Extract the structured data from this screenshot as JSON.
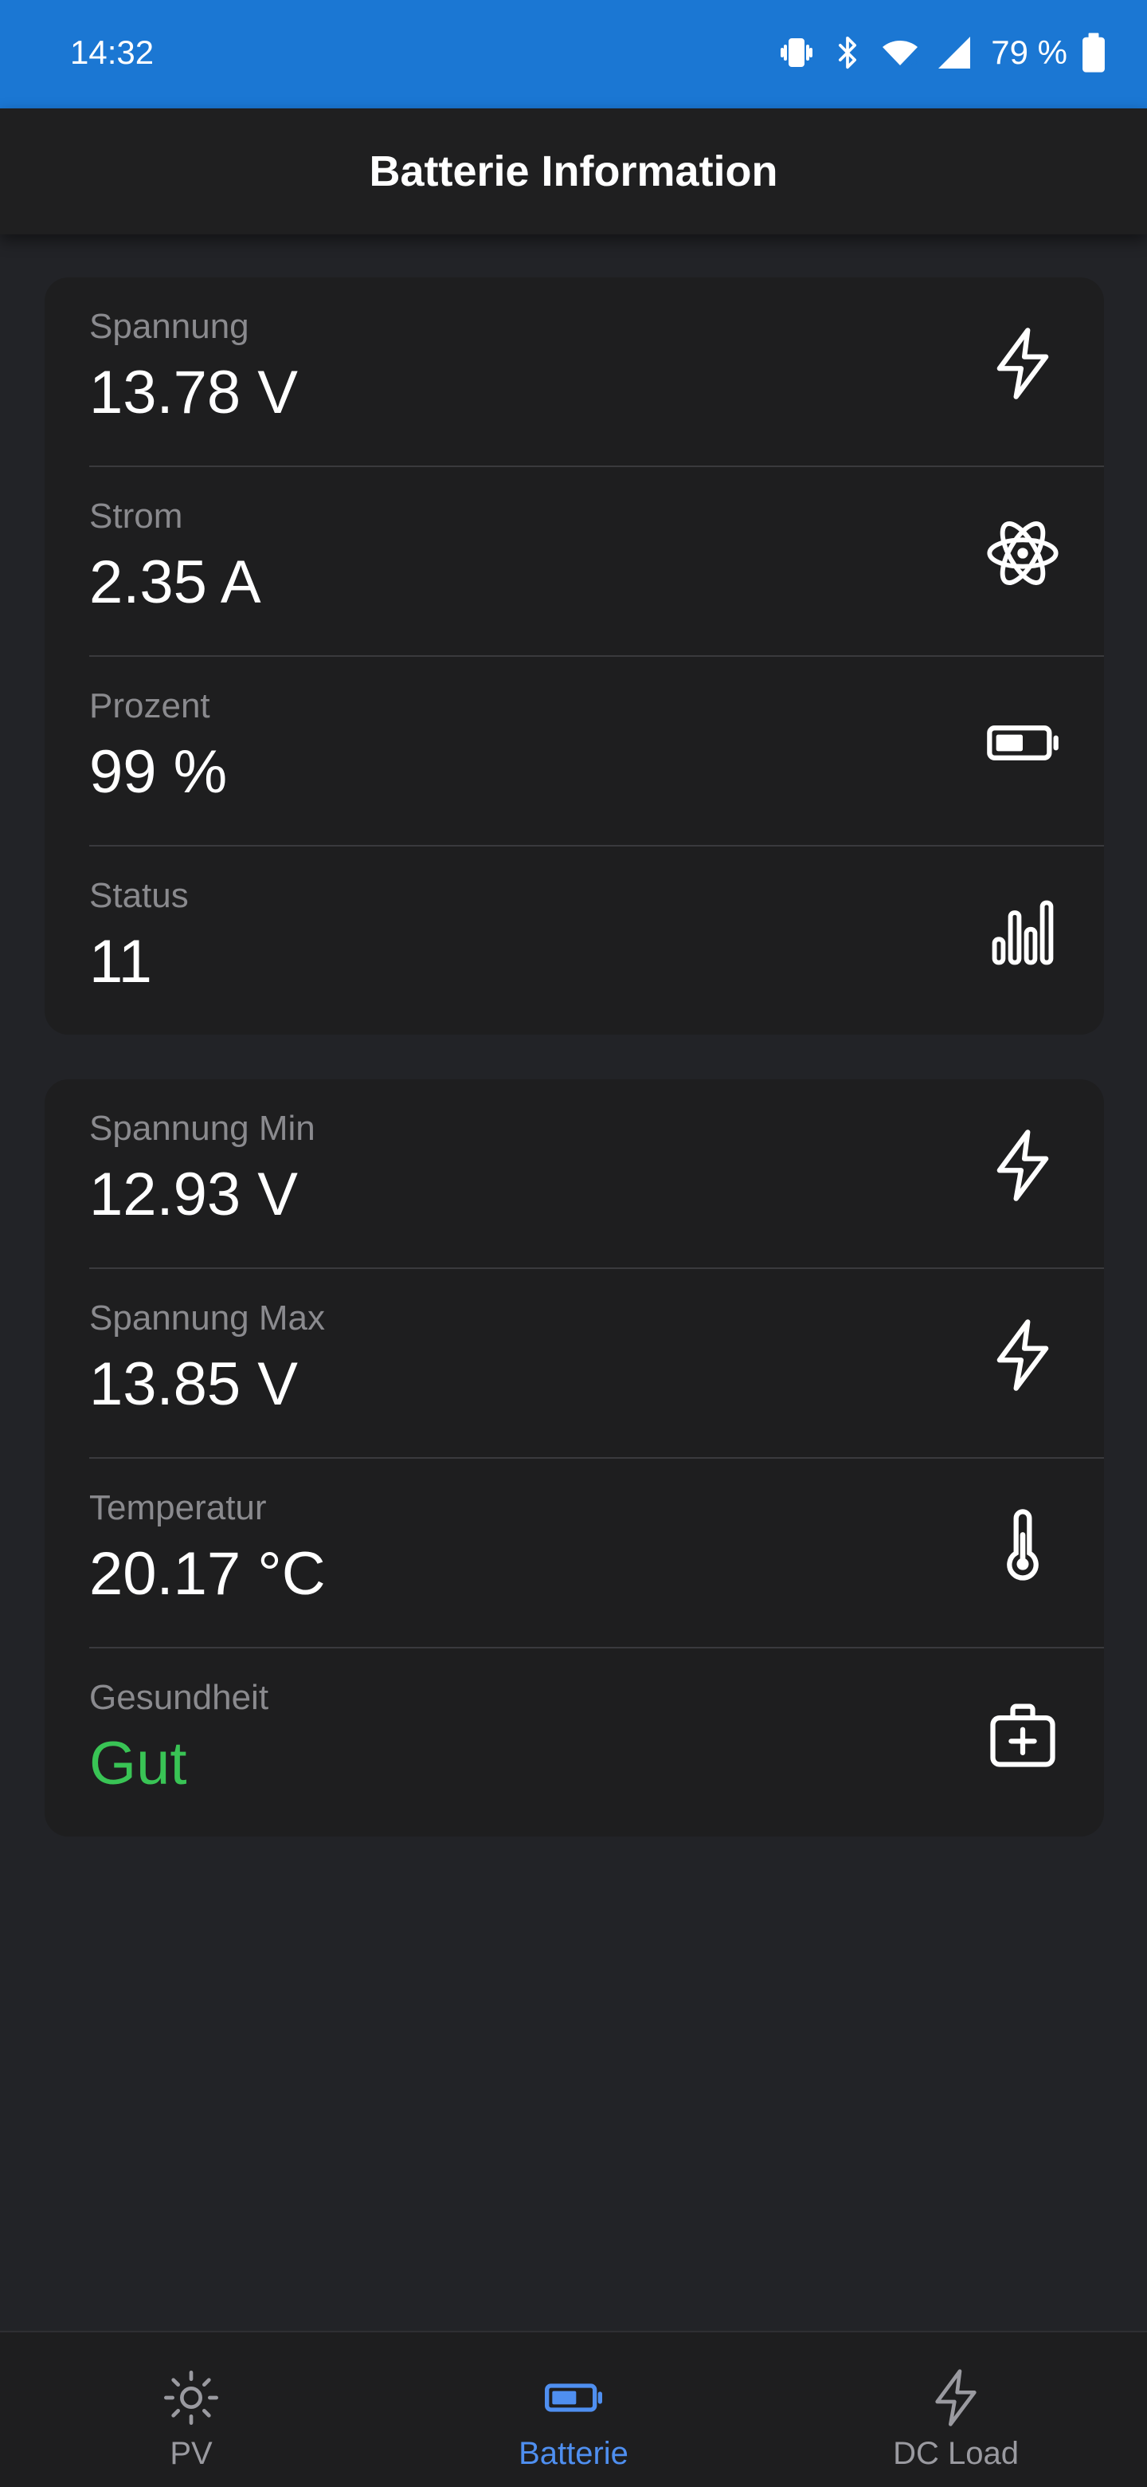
{
  "status_bar": {
    "time": "14:32",
    "battery_text": "79 %",
    "icons": [
      "vibrate-icon",
      "bluetooth-icon",
      "wifi-icon",
      "signal-icon",
      "battery-icon"
    ]
  },
  "app_bar": {
    "title": "Batterie Information"
  },
  "card_primary": {
    "rows": [
      {
        "label": "Spannung",
        "value": "13.78 V",
        "icon": "lightning-icon"
      },
      {
        "label": "Strom",
        "value": "2.35 A",
        "icon": "atom-icon"
      },
      {
        "label": "Prozent",
        "value": "99 %",
        "icon": "battery-level-icon"
      },
      {
        "label": "Status",
        "value": "11",
        "icon": "bar-chart-icon"
      }
    ]
  },
  "card_secondary": {
    "rows": [
      {
        "label": "Spannung Min",
        "value": "12.93 V",
        "icon": "lightning-icon"
      },
      {
        "label": "Spannung Max",
        "value": "13.85 V",
        "icon": "lightning-icon"
      },
      {
        "label": "Temperatur",
        "value": "20.17 °C",
        "icon": "thermometer-icon"
      },
      {
        "label": "Gesundheit",
        "value": "Gut",
        "icon": "first-aid-icon"
      }
    ]
  },
  "bottom_nav": {
    "items": [
      {
        "label": "PV",
        "icon": "sun-icon",
        "active": false
      },
      {
        "label": "Batterie",
        "icon": "battery-icon",
        "active": true
      },
      {
        "label": "DC Load",
        "icon": "lightning-icon",
        "active": false
      }
    ]
  },
  "colors": {
    "status_bar": "#1b77d3",
    "background": "#222327",
    "card": "#1e1e1f",
    "accent": "#4f8ff0",
    "good": "#39c455"
  }
}
